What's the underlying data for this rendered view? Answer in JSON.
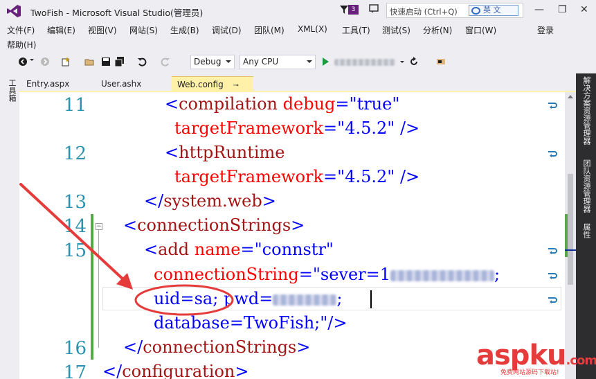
{
  "window": {
    "title": "TwoFish - Microsoft Visual Studio(管理员)",
    "notification_count": "3",
    "quick_launch_placeholder": "快速启动 (Ctrl+Q)",
    "ime_label": "英 文",
    "login_label": "登录"
  },
  "menu": {
    "items": [
      "文件(F)",
      "编辑(E)",
      "视图(V)",
      "网站(S)",
      "生成(B)",
      "调试(D)",
      "团队(M)",
      "XML(X)",
      "工具(T)",
      "测试(S)",
      "分析(N)",
      "窗口(W)"
    ],
    "help": "帮助(H)"
  },
  "toolbar": {
    "config": "Debug",
    "platform": "Any CPU"
  },
  "left_panel": {
    "toolbox_label": "工具箱"
  },
  "right_panel": {
    "tabs": [
      "解决方案资源管理器",
      "团队资源管理器",
      "属性"
    ]
  },
  "tabs": [
    {
      "label": "Entry.aspx",
      "active": false
    },
    {
      "label": "User.ashx",
      "active": false
    },
    {
      "label": "Web.config",
      "active": true
    }
  ],
  "editor": {
    "line_numbers": [
      "11",
      "12",
      "13",
      "14",
      "15",
      "16",
      "17"
    ],
    "lines": {
      "l11a_open": "<",
      "l11a_tag": "compilation",
      "l11a_attr": " debug",
      "l11a_eq": "=\"",
      "l11a_val": "true",
      "l11a_close": "\"",
      "l11b_attr": "targetFramework",
      "l11b_eq": "=\"",
      "l11b_val": "4.5.2",
      "l11b_close": "\" />",
      "l12a_open": "<",
      "l12a_tag": "httpRuntime",
      "l12b_attr": "targetFramework",
      "l12b_eq": "=\"",
      "l12b_val": "4.5.2",
      "l12b_close": "\" />",
      "l13_open": "</",
      "l13_tag": "system.web",
      "l13_close": ">",
      "l14_open": "<",
      "l14_tag": "connectionStrings",
      "l14_close": ">",
      "l15a_open": "<",
      "l15a_tag": "add",
      "l15a_attr": " name",
      "l15a_eq": "=\"",
      "l15a_val": "connstr",
      "l15a_close": "\"",
      "l15b_attr": "connectionString",
      "l15b_eq": "=\"",
      "l15b_val": "sever=1",
      "l15b_end": ";",
      "l15c_uid": "uid=sa; ",
      "l15c_pwd": "pwd=",
      "l15c_end": ";",
      "l15d_val": "database=TwoFish;",
      "l15d_close": "\"/>",
      "l16_open": "</",
      "l16_tag": "connectionStrings",
      "l16_close": ">",
      "l17_open": "</",
      "l17_tag": "configuration",
      "l17_close": ">"
    }
  },
  "watermark": {
    "main_a": "asp",
    "main_b": "ku",
    "suffix": ".com",
    "sub": "免费网站源码下载站!"
  },
  "colors": {
    "accent": "#68217a",
    "active_tab": "#fff1a8",
    "xml_tag": "#a31515",
    "xml_attr": "#ff0000",
    "xml_value": "#0000ff",
    "line_number": "#2b91af",
    "annotation": "#e53b3b"
  }
}
